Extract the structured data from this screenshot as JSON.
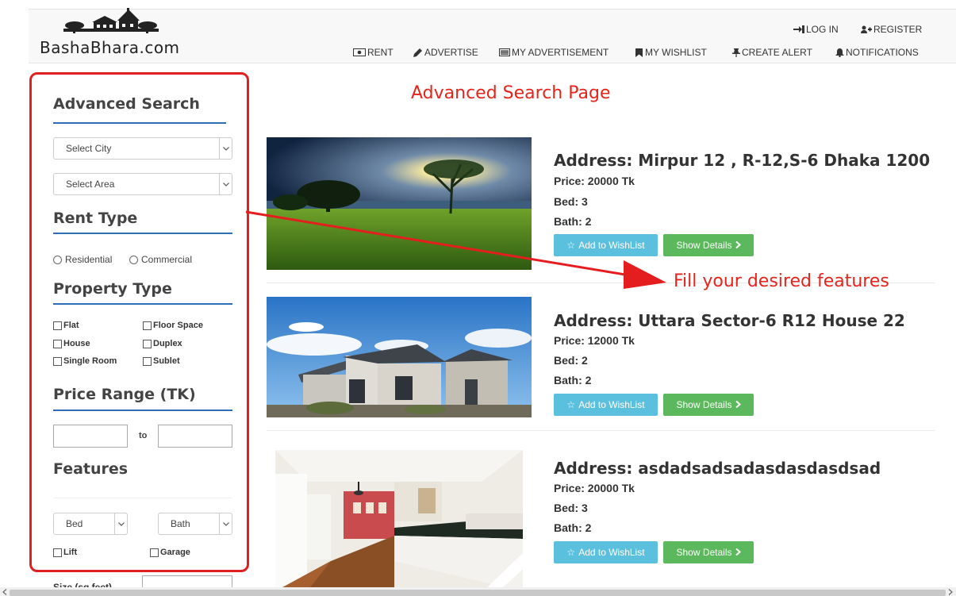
{
  "logo": {
    "text": "BashaBhara.com"
  },
  "auth": {
    "login": "LOG IN",
    "register": "REGISTER"
  },
  "nav": {
    "rent": "RENT",
    "advertise": "ADVERTISE",
    "my_advertisement": "MY ADVERTISEMENT",
    "my_wishlist": "MY WISHLIST",
    "create_alert": "CREATE ALERT",
    "notifications": "NOTIFICATIONS"
  },
  "annotations": {
    "page_title": "Advanced Search Page",
    "hint": "Fill your desired features"
  },
  "sidebar": {
    "title": "Advanced Search",
    "city_select": "Select City",
    "area_select": "Select Area",
    "rent_type": {
      "title": "Rent Type",
      "options": [
        "Residential",
        "Commercial"
      ]
    },
    "property_type": {
      "title": "Property Type",
      "options": [
        "Flat",
        "Floor Space",
        "House",
        "Duplex",
        "Single Room",
        "Sublet"
      ]
    },
    "price_range": {
      "title": "Price Range (TK)",
      "to": "to"
    },
    "features": {
      "title": "Features",
      "bed_select": "Bed",
      "bath_select": "Bath",
      "lift": "Lift",
      "garage": "Garage"
    },
    "size_label": "Size (sq.feet)"
  },
  "listings": [
    {
      "address": "Address: Mirpur 12 , R-12,S-6 Dhaka 1200",
      "price": "Price: 20000 Tk",
      "bed": "Bed: 3",
      "bath": "Bath: 2"
    },
    {
      "address": "Address: Uttara Sector-6 R12 House 22",
      "price": "Price: 12000 Tk",
      "bed": "Bed: 2",
      "bath": "Bath: 2"
    },
    {
      "address": "Address: asdadsadsadasdasdasdsad",
      "price": "Price: 20000 Tk",
      "bed": "Bed: 3",
      "bath": "Bath: 2"
    }
  ],
  "buttons": {
    "wishlist": "Add to WishList",
    "details": "Show Details"
  },
  "colors": {
    "accent_blue": "#2d6fb7",
    "annotation_red": "#e8231b",
    "wishlist_btn": "#5bc0de",
    "details_btn": "#5cb85c"
  }
}
